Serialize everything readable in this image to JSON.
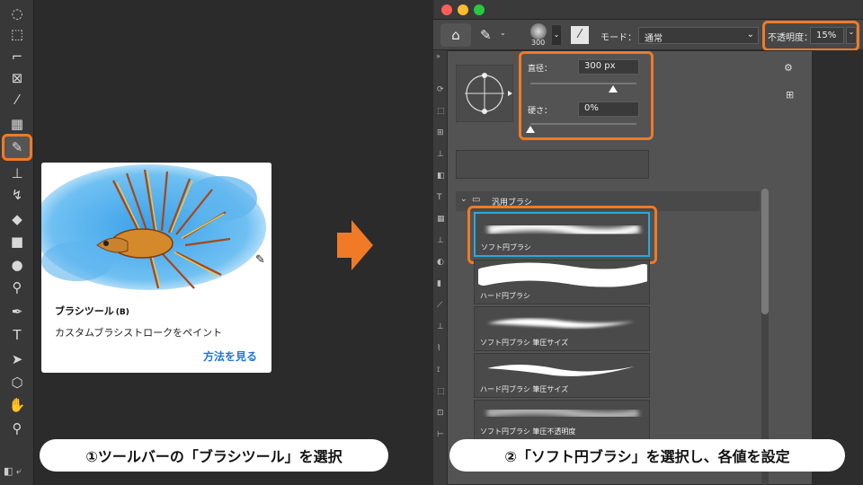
{
  "toolbar": {
    "tools": [
      {
        "name": "lasso-tool",
        "glyph": "◌"
      },
      {
        "name": "object-select-tool",
        "glyph": "⬚"
      },
      {
        "name": "crop-tool",
        "glyph": "⌐"
      },
      {
        "name": "frame-tool",
        "glyph": "⊠"
      },
      {
        "name": "eyedropper-tool",
        "glyph": "⁄"
      },
      {
        "name": "healing-tool",
        "glyph": "▦"
      },
      {
        "name": "brush-tool",
        "glyph": "✎"
      },
      {
        "name": "clone-stamp-tool",
        "glyph": "⊥"
      },
      {
        "name": "history-brush-tool",
        "glyph": "↯"
      },
      {
        "name": "eraser-tool",
        "glyph": "◆"
      },
      {
        "name": "gradient-tool",
        "glyph": "■"
      },
      {
        "name": "blur-tool",
        "glyph": "●"
      },
      {
        "name": "dodge-tool",
        "glyph": "⚲"
      },
      {
        "name": "pen-tool",
        "glyph": "✒"
      },
      {
        "name": "type-tool",
        "glyph": "T"
      },
      {
        "name": "path-select-tool",
        "glyph": "➤"
      },
      {
        "name": "shape-tool",
        "glyph": "⬡"
      },
      {
        "name": "hand-tool",
        "glyph": "✋"
      },
      {
        "name": "zoom-tool",
        "glyph": "⚲"
      }
    ],
    "bottom_glyph": "◧ ⤶"
  },
  "tooltip": {
    "title": "ブラシツール",
    "shortcut": "(B)",
    "description": "カスタムブラシストロークをペイント",
    "link": "方法を見る"
  },
  "captions": {
    "step1": "①ツールバーの「ブラシツール」を選択",
    "step2": "②「ソフト円ブラシ」を選択し、各値を設定"
  },
  "options_bar": {
    "brush_size_display": "300",
    "mode_label": "モード：",
    "mode_value": "通常",
    "opacity_label": "不透明度：",
    "opacity_value": "15%"
  },
  "brush_panel": {
    "size_label": "直径：",
    "size_value": "300 px",
    "size_slider_fraction": 0.78,
    "hardness_label": "硬さ：",
    "hardness_value": "0%",
    "hardness_slider_fraction": 0.0,
    "folder_name": "汎用ブラシ",
    "brushes": [
      {
        "label": "ソフト円ブラシ",
        "selected": true
      },
      {
        "label": "ハード円ブラシ",
        "selected": false
      },
      {
        "label": "ソフト円ブラシ 筆圧サイズ",
        "selected": false
      },
      {
        "label": "ハード円ブラシ 筆圧サイズ",
        "selected": false
      },
      {
        "label": "ソフト円ブラシ 筆圧不透明度",
        "selected": false
      }
    ]
  },
  "colors": {
    "accent": "#f07a26",
    "link": "#2375d4",
    "selection": "#27a9e1"
  }
}
